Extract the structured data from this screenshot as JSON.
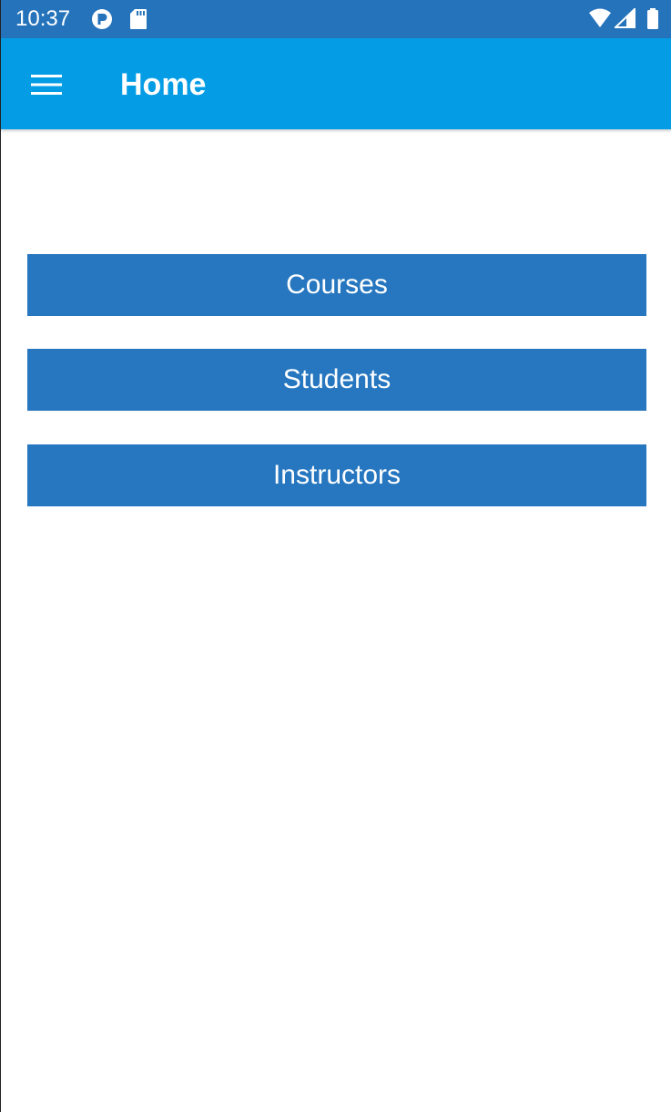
{
  "status_bar": {
    "time": "10:37",
    "left_icons": [
      "circle-p-icon",
      "sd-card-icon"
    ],
    "right_icons": [
      "wifi-icon",
      "cell-signal-icon",
      "battery-icon"
    ]
  },
  "app_bar": {
    "menu_icon": "hamburger-menu-icon",
    "title": "Home"
  },
  "buttons": {
    "courses": "Courses",
    "students": "Students",
    "instructors": "Instructors"
  },
  "colors": {
    "status_bar": "#2473bb",
    "app_bar": "#049de5",
    "button": "#2677c0",
    "button_text": "#ffffff",
    "background": "#ffffff"
  }
}
